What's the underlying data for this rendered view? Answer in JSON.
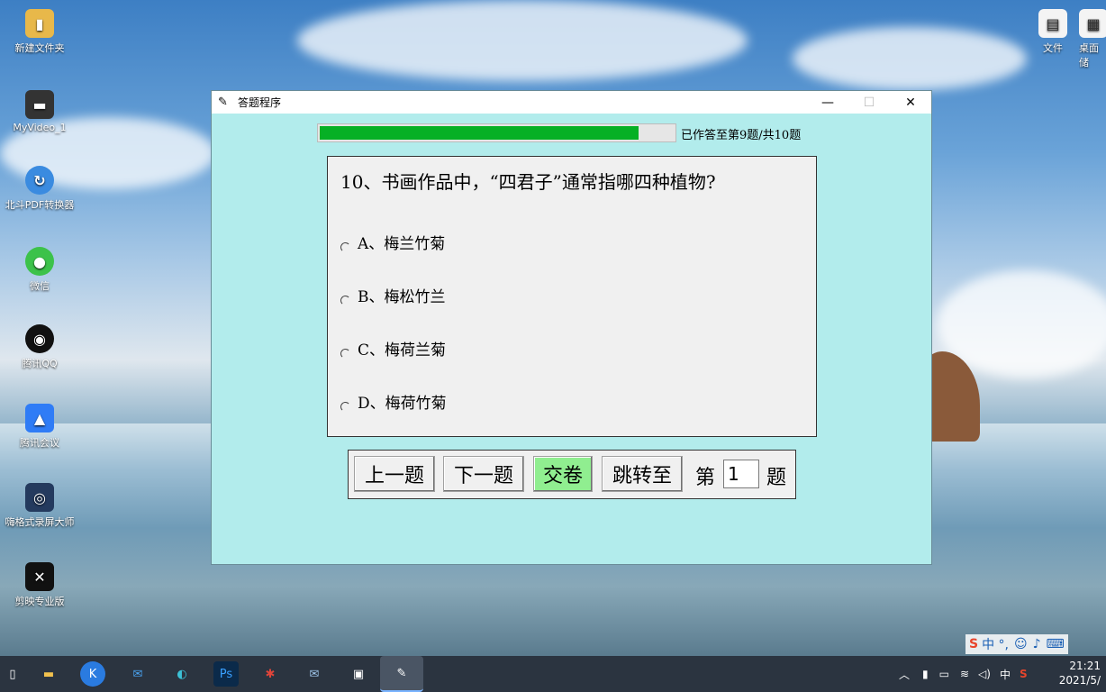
{
  "desktop": {
    "icons_left": [
      {
        "label": "新建文件夹",
        "icon": "folder-icon",
        "color": "#e8b84a"
      },
      {
        "label": "MyVideo_1",
        "icon": "video-file-icon",
        "color": "#333333"
      },
      {
        "label": "北斗PDF转换器",
        "icon": "pdf-converter-icon",
        "color": "#3a8be0"
      },
      {
        "label": "微信",
        "icon": "wechat-icon",
        "color": "#3cc24a"
      },
      {
        "label": "腾讯QQ",
        "icon": "qq-icon",
        "color": "#111111"
      },
      {
        "label": "腾讯会议",
        "icon": "tencent-meeting-icon",
        "color": "#2f7cf6"
      },
      {
        "label": "嗨格式录屏大师",
        "icon": "screen-recorder-icon",
        "color": "#243a5e"
      },
      {
        "label": "剪映专业版",
        "icon": "capcut-icon",
        "color": "#111111"
      }
    ],
    "icons_right": [
      {
        "label": "文件",
        "icon": "document-icon",
        "color": "#ffffff"
      },
      {
        "label": "桌面储",
        "icon": "desktop-storage-icon",
        "color": "#ffffff"
      }
    ]
  },
  "window": {
    "title": "答题程序",
    "title_icon": "feather-icon",
    "progress": {
      "fraction": 0.9,
      "text": "已作答至第9题/共10题"
    },
    "question": {
      "text": "10、书画作品中，“四君子”通常指哪四种植物?",
      "options": [
        "A、梅兰竹菊",
        "B、梅松竹兰",
        "C、梅荷兰菊",
        "D、梅荷竹菊"
      ]
    },
    "buttons": {
      "prev": "上一题",
      "next": "下一题",
      "submit": "交卷",
      "jump": "跳转至",
      "jump_prefix": "第",
      "jump_value": "1",
      "jump_suffix": "题"
    },
    "colors": {
      "background": "#b2ecec",
      "progress": "#06b025",
      "submit": "#90ee90"
    }
  },
  "taskbar": {
    "apps": [
      "file-explorer-icon",
      "kuwo-icon",
      "mail-icon",
      "edge-icon",
      "photoshop-icon",
      "spider-app-icon",
      "mail2-icon",
      "video-icon",
      "feather-app-icon"
    ],
    "photoshop_label": "Ps",
    "tray": {
      "ime_mode": "中",
      "ime_bar": "中 °,",
      "time": "21:21",
      "date": "2021/5/"
    }
  }
}
